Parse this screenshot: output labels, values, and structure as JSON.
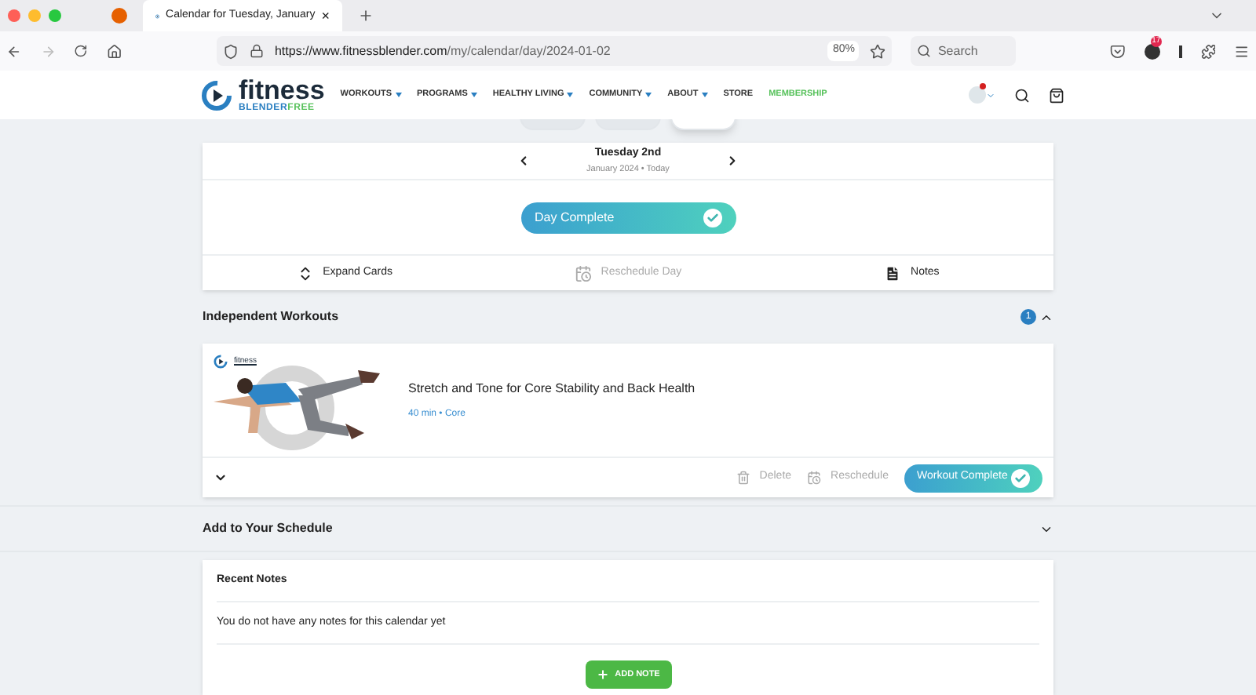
{
  "browser": {
    "tab_title": "Calendar for Tuesday, January",
    "tab_close": "×",
    "url_host": "https://www.fitnessblender.com",
    "url_path": "/my/calendar/day/2024-01-02",
    "zoom": "80%",
    "search_placeholder": "Search",
    "badge": "17"
  },
  "site": {
    "logo_word": "fitness",
    "logo_sub": "BLENDER",
    "logo_free": "FREE",
    "nav": [
      {
        "label": "WORKOUTS",
        "dropdown": true,
        "highlight": false
      },
      {
        "label": "PROGRAMS",
        "dropdown": true,
        "highlight": false
      },
      {
        "label": "HEALTHY LIVING",
        "dropdown": true,
        "highlight": false
      },
      {
        "label": "COMMUNITY",
        "dropdown": true,
        "highlight": false
      },
      {
        "label": "ABOUT",
        "dropdown": true,
        "highlight": false
      },
      {
        "label": "STORE",
        "dropdown": false,
        "highlight": false
      },
      {
        "label": "MEMBERSHIP",
        "dropdown": false,
        "highlight": true
      }
    ],
    "notification": true
  },
  "view_tabs": [
    {
      "selected": false
    },
    {
      "selected": false
    },
    {
      "selected": true
    }
  ],
  "day": {
    "title": "Tuesday 2nd",
    "subtitle": "January 2024 • Today",
    "complete_label": "Day Complete",
    "completed": true,
    "actions": [
      {
        "kind": "expand",
        "label": "Expand Cards",
        "disabled": false
      },
      {
        "kind": "reschedule",
        "label": "Reschedule Day",
        "disabled": true
      },
      {
        "kind": "notes",
        "label": "Notes",
        "disabled": false
      }
    ]
  },
  "independent": {
    "title": "Independent Workouts",
    "count": "1",
    "expanded": true,
    "workouts": [
      {
        "title": "Stretch and Tone for Core Stability and Back Health",
        "meta": "40 min • Core",
        "thumb_logo": "fitness",
        "delete": "Delete",
        "reschedule": "Reschedule",
        "complete_label": "Workout Complete",
        "completed": true
      }
    ]
  },
  "schedule": {
    "title": "Add to Your Schedule",
    "expanded": false
  },
  "notes": {
    "title": "Recent Notes",
    "empty": "You do not have any notes for this calendar yet",
    "add": "ADD NOTE"
  }
}
